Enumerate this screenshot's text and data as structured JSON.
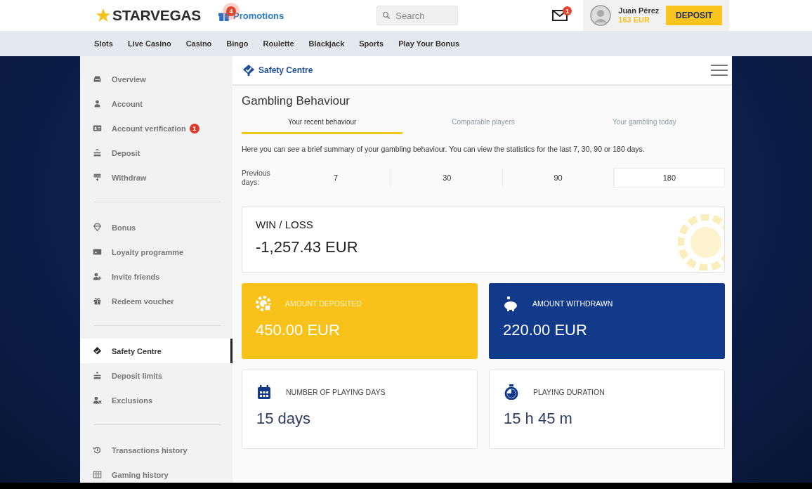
{
  "header": {
    "logo": "STARVEGAS",
    "promotions": {
      "label": "Promotions",
      "badge": "4"
    },
    "search": {
      "placeholder": "Search"
    },
    "mail_badge": "1",
    "user": {
      "name": "Juan Pérez",
      "balance": "163 EUR"
    },
    "deposit_button": "DEPOSIT"
  },
  "nav": [
    "Slots",
    "Live Casino",
    "Casino",
    "Bingo",
    "Roulette",
    "Blackjack",
    "Sports",
    "Play Your Bonus"
  ],
  "sidebar": {
    "groups": [
      [
        {
          "kind": "overview",
          "label": "Overview",
          "selected": false
        },
        {
          "kind": "account",
          "label": "Account",
          "selected": false
        },
        {
          "kind": "verification",
          "label": "Account verification",
          "badge": "1",
          "selected": false
        },
        {
          "kind": "deposit",
          "label": "Deposit",
          "selected": false
        },
        {
          "kind": "withdraw",
          "label": "Withdraw",
          "selected": false
        }
      ],
      [
        {
          "kind": "bonus",
          "label": "Bonus",
          "selected": false
        },
        {
          "kind": "loyalty",
          "label": "Loyalty programme",
          "selected": false
        },
        {
          "kind": "invite",
          "label": "Invite friends",
          "selected": false
        },
        {
          "kind": "voucher",
          "label": "Redeem voucher",
          "selected": false
        }
      ],
      [
        {
          "kind": "safety",
          "label": "Safety Centre",
          "selected": true
        },
        {
          "kind": "limits",
          "label": "Deposit limits",
          "selected": false
        },
        {
          "kind": "exclusions",
          "label": "Exclusions",
          "selected": false
        }
      ],
      [
        {
          "kind": "transactions",
          "label": "Transactions history",
          "selected": false
        },
        {
          "kind": "gaming",
          "label": "Gaming history",
          "selected": false
        }
      ]
    ]
  },
  "panel": {
    "title": "Safety Centre",
    "heading": "Gambling Behaviour",
    "tabs": [
      {
        "label": "Your recent behaviour",
        "selected": true
      },
      {
        "label": "Comparable players",
        "selected": false
      },
      {
        "label": "Your gambling today",
        "selected": false
      }
    ],
    "description": "Here you can see a brief summary of your gambling behaviour. You can view the statistics for the last 7, 30, 90 or 180 days.",
    "period": {
      "label": "Previous days:",
      "options": [
        {
          "label": "7",
          "selected": false
        },
        {
          "label": "30",
          "selected": false
        },
        {
          "label": "90",
          "selected": false
        },
        {
          "label": "180",
          "selected": true
        }
      ]
    },
    "win_loss": {
      "label": "WIN / LOSS",
      "value": "-1,257.43 EUR"
    },
    "stats": [
      {
        "kind": "deposited",
        "label": "AMOUNT DEPOSITED",
        "value": "450.00 EUR"
      },
      {
        "kind": "withdrawn",
        "label": "AMOUNT WITHDRAWN",
        "value": "220.00 EUR"
      },
      {
        "kind": "days",
        "label": "NUMBER OF PLAYING DAYS",
        "value": "15 days"
      },
      {
        "kind": "duration",
        "label": "PLAYING DURATION",
        "value": "15 h 45 m"
      }
    ]
  }
}
